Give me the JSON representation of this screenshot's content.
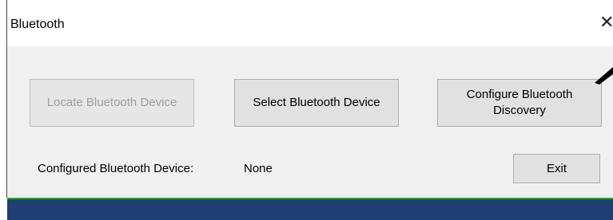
{
  "window": {
    "title": "Bluetooth",
    "close_glyph": "✕"
  },
  "buttons": {
    "locate_label": "Locate Bluetooth Device",
    "select_label": "Select Bluetooth Device",
    "configure_label": "Configure Bluetooth Discovery",
    "exit_label": "Exit"
  },
  "status": {
    "configured_label": "Configured Bluetooth Device:",
    "configured_value": "None"
  },
  "colors": {
    "accent_line": "#2eaa3a",
    "bottom_bar": "#1f3f73",
    "dialog_bg": "#f0f0f0"
  },
  "icons": {
    "close": "close-icon",
    "pointer_arrow": "arrow-icon"
  }
}
